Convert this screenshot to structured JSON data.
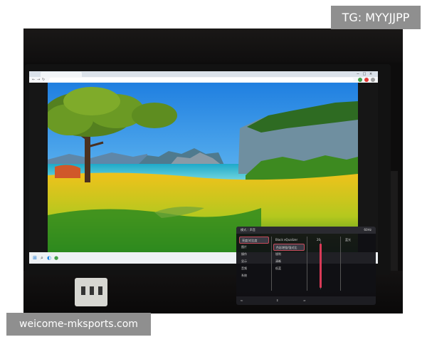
{
  "watermarks": {
    "top_right": "TG: MYYJJPP",
    "bottom_left": "weicome-mksports.com"
  },
  "browser": {
    "icons": [
      "tab-favicon",
      "back-icon",
      "forward-icon",
      "reload-icon",
      "minimize-icon",
      "maximize-icon",
      "close-icon"
    ]
  },
  "osd": {
    "header_left": "模式｜声音",
    "header_right": "60Hz",
    "menu_items": [
      "亮度/对比度",
      "图片",
      "操作",
      "显示",
      "音频",
      "系统"
    ],
    "option_column_1": [
      "Black eQualizer",
      "色彩增强/强对比",
      "锐利",
      "清晰",
      "低蓝"
    ],
    "column_3_header": "20",
    "column_4_header": "蓝光"
  },
  "colors": {
    "slider_accent": "#d93a57",
    "watermark_bg": "#8f8f8f",
    "sky": "#2f8fe0",
    "grass": "#e0b21a"
  }
}
